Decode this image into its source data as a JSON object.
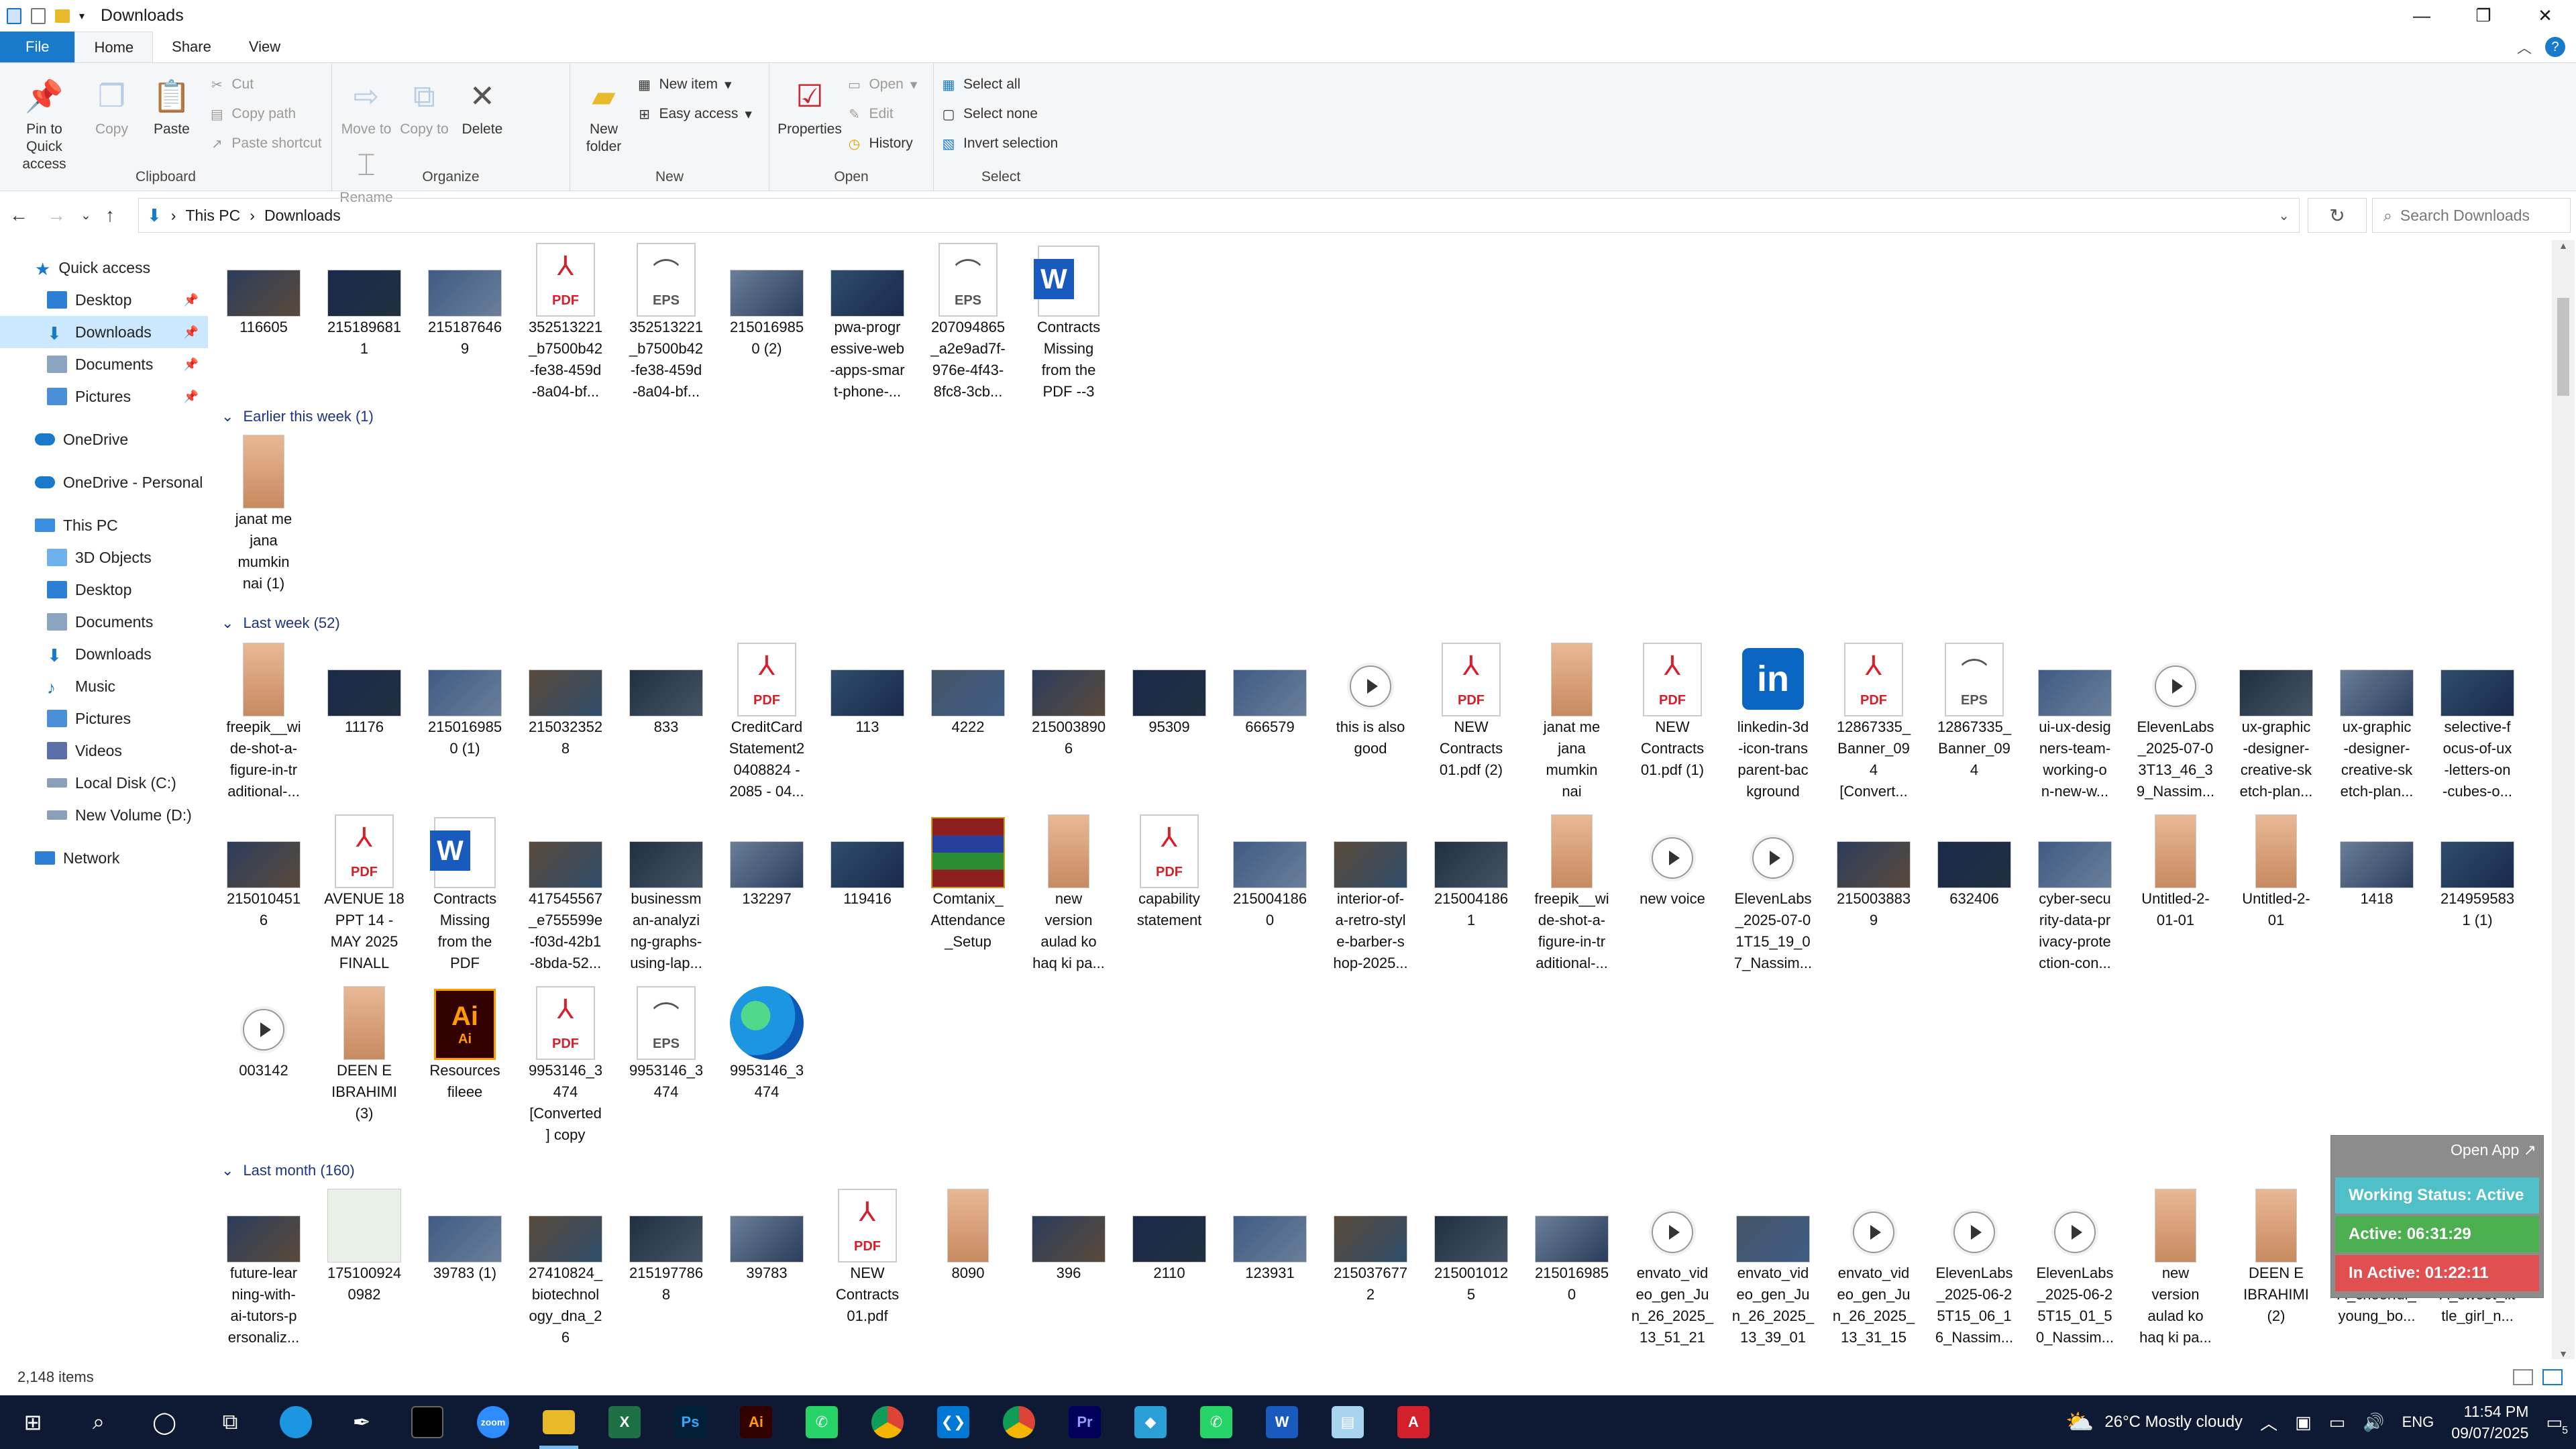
{
  "window": {
    "title": "Downloads",
    "min": "—",
    "max": "❐",
    "close": "✕"
  },
  "ribbon_tabs": {
    "file": "File",
    "home": "Home",
    "share": "Share",
    "view": "View"
  },
  "clipboard": {
    "pin": "Pin to Quick access",
    "copy": "Copy",
    "paste": "Paste",
    "cut": "Cut",
    "copy_path": "Copy path",
    "paste_shortcut": "Paste shortcut",
    "label": "Clipboard"
  },
  "organize": {
    "move": "Move to",
    "copy_to": "Copy to",
    "delete": "Delete",
    "rename": "Rename",
    "label": "Organize"
  },
  "newgrp": {
    "new_folder": "New folder",
    "new_item": "New item",
    "easy_access": "Easy access",
    "label": "New"
  },
  "opengrp": {
    "properties": "Properties",
    "open": "Open",
    "edit": "Edit",
    "history": "History",
    "label": "Open"
  },
  "selectgrp": {
    "select_all": "Select all",
    "select_none": "Select none",
    "invert": "Invert selection",
    "label": "Select"
  },
  "address": {
    "this_pc": "This PC",
    "downloads": "Downloads",
    "search_placeholder": "Search Downloads"
  },
  "nav": {
    "quick_access": "Quick access",
    "qa_desktop": "Desktop",
    "qa_downloads": "Downloads",
    "qa_documents": "Documents",
    "qa_pictures": "Pictures",
    "onedrive": "OneDrive",
    "onedrive_personal": "OneDrive - Personal",
    "this_pc": "This PC",
    "objects3d": "3D Objects",
    "desktop": "Desktop",
    "documents": "Documents",
    "downloads": "Downloads",
    "music": "Music",
    "pictures": "Pictures",
    "videos": "Videos",
    "local_disk": "Local Disk (C:)",
    "new_volume": "New Volume (D:)",
    "network": "Network"
  },
  "groups": {
    "earlier": "Earlier this week (1)",
    "lastweek": "Last week (52)",
    "lastmonth": "Last month (160)"
  },
  "top_row": [
    {
      "t": "img",
      "c": [
        "116605"
      ]
    },
    {
      "t": "img",
      "c": [
        "215189681",
        "1"
      ]
    },
    {
      "t": "img",
      "c": [
        "215187646",
        "9"
      ]
    },
    {
      "t": "pdf",
      "c": [
        "352513221",
        "_b7500b42",
        "-fe38-459d",
        "-8a04-bf..."
      ]
    },
    {
      "t": "eps",
      "c": [
        "352513221",
        "_b7500b42",
        "-fe38-459d",
        "-8a04-bf..."
      ]
    },
    {
      "t": "img",
      "c": [
        "215016985",
        "0 (2)"
      ]
    },
    {
      "t": "img",
      "c": [
        "pwa-progr",
        "essive-web",
        "-apps-smar",
        "t-phone-..."
      ]
    },
    {
      "t": "eps",
      "c": [
        "207094865",
        "_a2e9ad7f-",
        "976e-4f43-",
        "8fc8-3cb..."
      ]
    },
    {
      "t": "word",
      "c": [
        "Contracts",
        "Missing",
        "from the",
        "PDF --3"
      ]
    }
  ],
  "earlier_row": [
    {
      "t": "tall",
      "c": [
        "janat me",
        "jana",
        "mumkin",
        "nai (1)"
      ]
    }
  ],
  "lastweek_row1": [
    {
      "t": "tall",
      "c": [
        "freepik__wi",
        "de-shot-a-",
        "figure-in-tr",
        "aditional-..."
      ]
    },
    {
      "t": "img",
      "c": [
        "11176"
      ]
    },
    {
      "t": "img",
      "c": [
        "215016985",
        "0 (1)"
      ]
    },
    {
      "t": "img",
      "c": [
        "215032352",
        "8"
      ]
    },
    {
      "t": "img",
      "c": [
        "833"
      ]
    },
    {
      "t": "pdf",
      "c": [
        "CreditCard",
        "Statement2",
        "0408824 -",
        "2085 - 04..."
      ]
    },
    {
      "t": "img",
      "c": [
        "113"
      ]
    },
    {
      "t": "img",
      "c": [
        "4222"
      ]
    },
    {
      "t": "img",
      "c": [
        "215003890",
        "6"
      ]
    },
    {
      "t": "img",
      "c": [
        "95309"
      ]
    },
    {
      "t": "img",
      "c": [
        "666579"
      ]
    },
    {
      "t": "vid",
      "c": [
        "this is also",
        "good"
      ]
    },
    {
      "t": "pdf",
      "c": [
        "NEW",
        "Contracts",
        "01.pdf (2)"
      ]
    },
    {
      "t": "tall",
      "c": [
        "janat me",
        "jana",
        "mumkin",
        "nai"
      ]
    },
    {
      "t": "pdf",
      "c": [
        "NEW",
        "Contracts",
        "01.pdf (1)"
      ]
    },
    {
      "t": "li",
      "c": [
        "linkedin-3d",
        "-icon-trans",
        "parent-bac",
        "kground"
      ]
    },
    {
      "t": "pdf",
      "c": [
        "12867335_",
        "Banner_09",
        "4",
        "[Convert..."
      ]
    },
    {
      "t": "eps",
      "c": [
        "12867335_",
        "Banner_09",
        "4"
      ]
    },
    {
      "t": "img",
      "c": [
        "ui-ux-desig",
        "ners-team-",
        "working-o",
        "n-new-w..."
      ]
    },
    {
      "t": "vid",
      "c": [
        "ElevenLabs",
        "_2025-07-0",
        "3T13_46_3",
        "9_Nassim..."
      ]
    },
    {
      "t": "img",
      "c": [
        "ux-graphic",
        "-designer-",
        "creative-sk",
        "etch-plan..."
      ]
    },
    {
      "t": "img",
      "c": [
        "ux-graphic",
        "-designer-",
        "creative-sk",
        "etch-plan..."
      ]
    },
    {
      "t": "img",
      "c": [
        "selective-f",
        "ocus-of-ux",
        "-letters-on",
        "-cubes-o..."
      ]
    }
  ],
  "lastweek_row2": [
    {
      "t": "img",
      "c": [
        "215010451",
        "6"
      ]
    },
    {
      "t": "pdf",
      "c": [
        "AVENUE 18",
        "PPT 14 -",
        "MAY 2025",
        "FINALL"
      ]
    },
    {
      "t": "word",
      "c": [
        "Contracts",
        "Missing",
        "from the",
        "PDF"
      ]
    },
    {
      "t": "img",
      "c": [
        "417545567",
        "_e755599e",
        "-f03d-42b1",
        "-8bda-52..."
      ]
    },
    {
      "t": "img",
      "c": [
        "businessm",
        "an-analyzi",
        "ng-graphs-",
        "using-lap..."
      ]
    },
    {
      "t": "img",
      "c": [
        "132297"
      ]
    },
    {
      "t": "img",
      "c": [
        "119416"
      ]
    },
    {
      "t": "rar",
      "c": [
        "Comtanix_",
        "Attendance",
        "_Setup"
      ]
    },
    {
      "t": "tall",
      "c": [
        "new",
        "version",
        "aulad ko",
        "haq ki pa..."
      ]
    },
    {
      "t": "pdf",
      "c": [
        "capability",
        "statement"
      ]
    },
    {
      "t": "img",
      "c": [
        "215004186",
        "0"
      ]
    },
    {
      "t": "img",
      "c": [
        "interior-of-",
        "a-retro-styl",
        "e-barber-s",
        "hop-2025..."
      ]
    },
    {
      "t": "img",
      "c": [
        "215004186",
        "1"
      ]
    },
    {
      "t": "tall",
      "c": [
        "freepik__wi",
        "de-shot-a-",
        "figure-in-tr",
        "aditional-..."
      ]
    },
    {
      "t": "vid",
      "c": [
        "new voice"
      ]
    },
    {
      "t": "vid",
      "c": [
        "ElevenLabs",
        "_2025-07-0",
        "1T15_19_0",
        "7_Nassim..."
      ]
    },
    {
      "t": "img",
      "c": [
        "215003883",
        "9"
      ]
    },
    {
      "t": "img",
      "c": [
        "632406"
      ]
    },
    {
      "t": "img",
      "c": [
        "cyber-secu",
        "rity-data-pr",
        "ivacy-prote",
        "ction-con..."
      ]
    },
    {
      "t": "tall",
      "c": [
        "Untitled-2-",
        "01-01"
      ]
    },
    {
      "t": "tall",
      "c": [
        "Untitled-2-",
        "01"
      ]
    },
    {
      "t": "img",
      "c": [
        "1418"
      ]
    },
    {
      "t": "img",
      "c": [
        "214959583",
        "1 (1)"
      ]
    }
  ],
  "lastweek_row3": [
    {
      "t": "vid",
      "c": [
        "003142"
      ]
    },
    {
      "t": "tall",
      "c": [
        "DEEN E",
        "IBRAHIMI",
        "(3)"
      ]
    },
    {
      "t": "ai",
      "c": [
        "Resources",
        "fileee"
      ]
    },
    {
      "t": "pdf",
      "c": [
        "9953146_3",
        "474",
        "[Converted",
        "] copy"
      ]
    },
    {
      "t": "eps",
      "c": [
        "9953146_3",
        "474"
      ]
    },
    {
      "t": "edge",
      "c": [
        "9953146_3",
        "474"
      ]
    }
  ],
  "lastmonth_row": [
    {
      "t": "img",
      "c": [
        "future-lear",
        "ning-with-",
        "ai-tutors-p",
        "ersonaliz..."
      ]
    },
    {
      "t": "sq",
      "c": [
        "175100924",
        "0982"
      ]
    },
    {
      "t": "img",
      "c": [
        "39783 (1)"
      ]
    },
    {
      "t": "img",
      "c": [
        "27410824_",
        "biotechnol",
        "ogy_dna_2",
        "6"
      ]
    },
    {
      "t": "img",
      "c": [
        "215197786",
        "8"
      ]
    },
    {
      "t": "img",
      "c": [
        "39783"
      ]
    },
    {
      "t": "pdf",
      "c": [
        "NEW",
        "Contracts",
        "01.pdf"
      ]
    },
    {
      "t": "tall",
      "c": [
        "8090"
      ]
    },
    {
      "t": "img",
      "c": [
        "396"
      ]
    },
    {
      "t": "img",
      "c": [
        "2110"
      ]
    },
    {
      "t": "img",
      "c": [
        "123931"
      ]
    },
    {
      "t": "img",
      "c": [
        "215037677",
        "2"
      ]
    },
    {
      "t": "img",
      "c": [
        "215001012",
        "5"
      ]
    },
    {
      "t": "img",
      "c": [
        "215016985",
        "0"
      ]
    },
    {
      "t": "vid",
      "c": [
        "envato_vid",
        "eo_gen_Ju",
        "n_26_2025_",
        "13_51_21"
      ]
    },
    {
      "t": "img",
      "c": [
        "envato_vid",
        "eo_gen_Ju",
        "n_26_2025_",
        "13_39_01"
      ]
    },
    {
      "t": "vid",
      "c": [
        "envato_vid",
        "eo_gen_Ju",
        "n_26_2025_",
        "13_31_15"
      ]
    },
    {
      "t": "vid",
      "c": [
        "ElevenLabs",
        "_2025-06-2",
        "5T15_06_1",
        "6_Nassim..."
      ]
    },
    {
      "t": "vid",
      "c": [
        "ElevenLabs",
        "_2025-06-2",
        "5T15_01_5",
        "0_Nassim..."
      ]
    },
    {
      "t": "tall",
      "c": [
        "new",
        "version",
        "aulad ko",
        "haq ki pa..."
      ]
    },
    {
      "t": "tall",
      "c": [
        "DEEN E",
        "IBRAHIMI",
        "(2)"
      ]
    },
    {
      "t": "img",
      "c": [
        "Vision_XL_",
        "A_cheerful_",
        "young_bo..."
      ]
    },
    {
      "t": "img",
      "c": [
        "Vision_XL_",
        "A_sweet_lit",
        "tle_girl_n..."
      ]
    }
  ],
  "statusbar": {
    "count": "2,148 items"
  },
  "popup": {
    "open_app": "Open App ↗",
    "working": "Working Status: Active",
    "active": "Active: 06:31:29",
    "inactive": "In Active: 01:22:11"
  },
  "taskbar": {
    "weather": "26°C  Mostly cloudy",
    "lang": "ENG",
    "time": "11:54 PM",
    "date": "09/07/2025",
    "notif": "5"
  },
  "colors": {
    "accent": "#1979ca",
    "selected": "#cce8ff",
    "header": "#1e3287",
    "active_green": "#4caf50",
    "inactive_red": "#e05050",
    "working_teal": "#4fc0c8",
    "taskbar": "#0e1a33"
  }
}
